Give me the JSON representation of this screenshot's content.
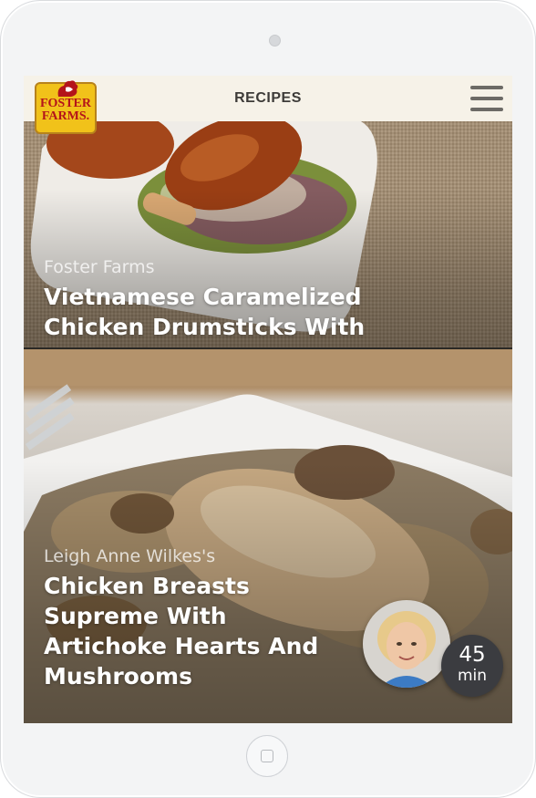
{
  "header": {
    "logo_text": "FOSTER\nFARMS.",
    "title": "RECIPES",
    "menu_icon": "hamburger-menu-icon"
  },
  "recipes": [
    {
      "source": "Foster Farms",
      "title": "Vietnamese Caramelized Chicken Drumsticks With Apple Slaw"
    },
    {
      "source": "Leigh Anne Wilkes's",
      "title": "Chicken Breasts Supreme With Artichoke Hearts And Mushrooms",
      "time_value": "45",
      "time_unit": "min"
    }
  ],
  "colors": {
    "header_bg": "#f6f2e8",
    "title_text": "#3d3b38",
    "logo_yellow": "#f1c21a",
    "logo_red": "#b4141a",
    "badge_bg": "#3b3c40"
  }
}
